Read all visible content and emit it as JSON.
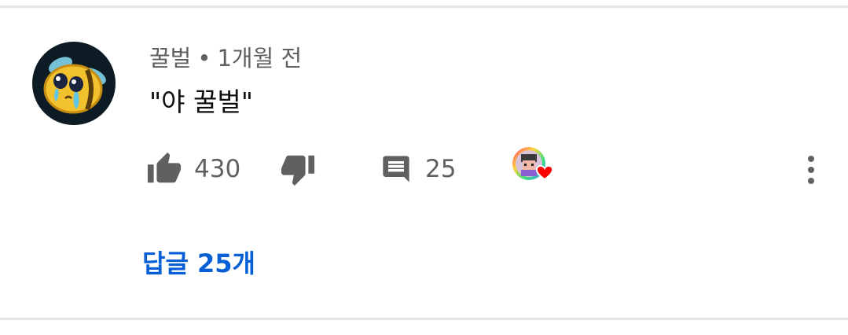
{
  "comment": {
    "author": "꿀벌",
    "separator": "•",
    "time": "1개월 전",
    "text": "\"야 꿀벌\""
  },
  "actions": {
    "like_count": "430",
    "reply_count": "25",
    "like_icon": "thumbs-up-icon",
    "dislike_icon": "thumbs-down-icon",
    "reply_icon": "comment-icon",
    "more_icon": "more-vertical-icon",
    "heart_color": "#ff0000"
  },
  "replies": {
    "label": "답글 25개"
  },
  "colors": {
    "link": "#065fd4",
    "secondary_text": "#606060",
    "divider": "#e5e5e5"
  }
}
